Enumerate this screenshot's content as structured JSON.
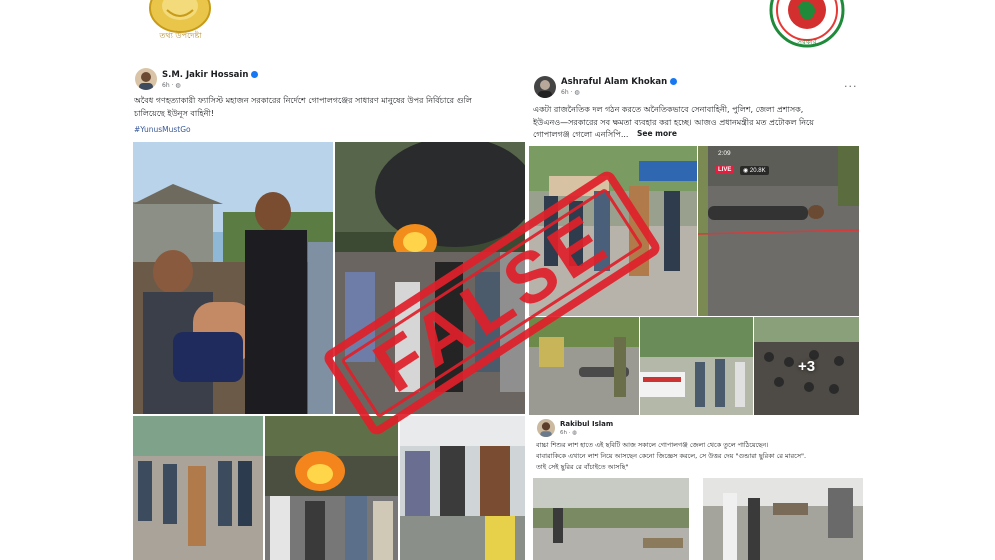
{
  "logos": {
    "left": {
      "caption": "তথ্য উপদেষ্টা"
    },
    "right": {
      "caption": "সরকার"
    }
  },
  "posts": [
    {
      "author": "S.M. Jakir Hossain",
      "time": "6h · ◍",
      "text_line1": "অবৈধ গণহত্যাকারী ফ্যাসিস্ট মহাজন সরকারের নির্দেশে গোপালগঞ্জের সাধারণ মানুষের উপর নির্বিচারে গুলি",
      "text_line2": "চালিয়েছে ইউনূস বাহিনী!",
      "hashtag": "#YunusMustGo"
    },
    {
      "author": "Ashraful Alam Khokan",
      "time": "6h · ◍",
      "text_line1": "একটা রাজনৈতিক দল গঠন করতে অনৈতিকভাবে সেনাবাহিনী, পুলিশ, জেলা প্রশাসক,",
      "text_line2": "ইউএনও—সরকারের সব ক্ষমতা ব্যবহার করা হচ্ছে। আজও প্রধানমন্ত্রীর মত প্রটোকল নিয়ে",
      "text_line3": "গোপালগঞ্জ গেলো এনসিপি...",
      "see_more": "See more",
      "live_badge": "LIVE",
      "viewers": "◉ 20.8K",
      "clock": "2:09",
      "more_count": "+3"
    },
    {
      "author": "Rakibul Islam",
      "time": "6h · ◍",
      "text_line1": "বাচ্চা শিশুর লাশ হাতে এই ছবিটি আজ সকালে গোপালগঞ্জ জেলা থেকে তুলে পাঠিয়েছেন।",
      "text_line2": "বাবারাকিকে এখানে লাশ নিয়ে আসছেন কেনো জিজ্ঞেস করলে, সে উত্তর দেয় \"গুন্ডারা ছুরিকা রে মারসে\".",
      "text_line3": "তাই সেই ছুরির রে বাঁচাইতে আসছি\""
    }
  ],
  "stamp": {
    "text": "FALSE",
    "color": "#e0202a"
  },
  "colors": {
    "verified": "#1877f2",
    "link": "#385898",
    "meta": "#65676b"
  },
  "icons": [
    "verified-badge-icon",
    "more-options-icon",
    "globe-icon",
    "eye-icon"
  ]
}
